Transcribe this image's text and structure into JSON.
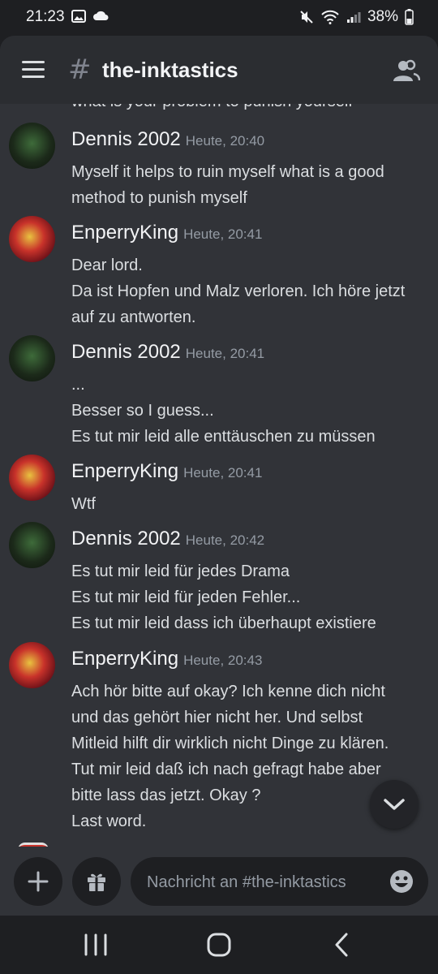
{
  "status_bar": {
    "time": "21:23",
    "battery": "38%"
  },
  "header": {
    "channel_name": "the-inktastics",
    "hash_symbol": "#"
  },
  "partial_line": "what is your problem to punish yourself",
  "messages": [
    {
      "author": "Dennis 2002",
      "timestamp": "Heute, 20:40",
      "avatar": "dennis",
      "lines": [
        "Myself it helps to ruin myself what is a good",
        "method to punish myself"
      ]
    },
    {
      "author": "EnperryKing",
      "timestamp": "Heute, 20:41",
      "avatar": "enperry",
      "lines": [
        "Dear lord.",
        "Da ist Hopfen und Malz verloren. Ich höre jetzt",
        "auf zu antworten."
      ]
    },
    {
      "author": "Dennis 2002",
      "timestamp": "Heute, 20:41",
      "avatar": "dennis",
      "lines": [
        "...",
        "Besser so I guess...",
        "Es tut mir leid alle enttäuschen zu müssen"
      ]
    },
    {
      "author": "EnperryKing",
      "timestamp": "Heute, 20:41",
      "avatar": "enperry",
      "lines": [
        "Wtf"
      ]
    },
    {
      "author": "Dennis 2002",
      "timestamp": "Heute, 20:42",
      "avatar": "dennis",
      "lines": [
        "Es tut mir leid für jedes Drama",
        "Es tut mir leid für jeden Fehler...",
        "Es tut mir leid dass ich überhaupt existiere"
      ]
    },
    {
      "author": "EnperryKing",
      "timestamp": "Heute, 20:43",
      "avatar": "enperry",
      "lines": [
        "Ach hör bitte auf okay? Ich kenne dich nicht",
        "und das gehört hier nicht her. Und selbst",
        "Mitleid hilft dir wirklich nicht Dinge zu klären.",
        "Tut mir leid daß ich nach gefragt habe aber",
        "bitte lass das jetzt.  Okay ?",
        "Last word."
      ]
    }
  ],
  "composer": {
    "placeholder": "Nachricht an #the-inktastics"
  },
  "colors": {
    "background": "#313338",
    "header": "#2b2d31",
    "text": "#dbdee1",
    "muted": "#949ba4"
  },
  "icons": [
    "menu-icon",
    "hash-icon",
    "members-icon",
    "plus-icon",
    "gift-icon",
    "emoji-icon",
    "chevron-down-icon",
    "recents-icon",
    "home-icon",
    "back-icon"
  ]
}
